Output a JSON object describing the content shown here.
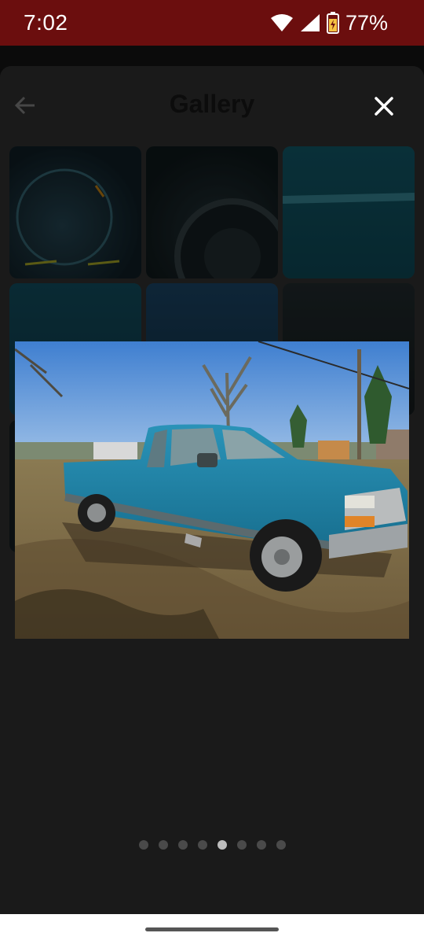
{
  "status_bar": {
    "time": "7:02",
    "battery": "77%",
    "icons": [
      "wifi-icon",
      "cellular-signal-icon",
      "battery-charging-icon"
    ]
  },
  "header": {
    "title": "Gallery",
    "back_icon": "arrow-left-icon",
    "close_icon": "close-icon"
  },
  "viewer": {
    "photo_subject": "teal pickup truck photo",
    "page_count": 8,
    "current_page": 5
  },
  "colors": {
    "status_bar": "#6b0e0e",
    "sheet": "#1a1a1a",
    "dot_active": "#bdbdbd",
    "dot_inactive": "#4a4a4a"
  }
}
